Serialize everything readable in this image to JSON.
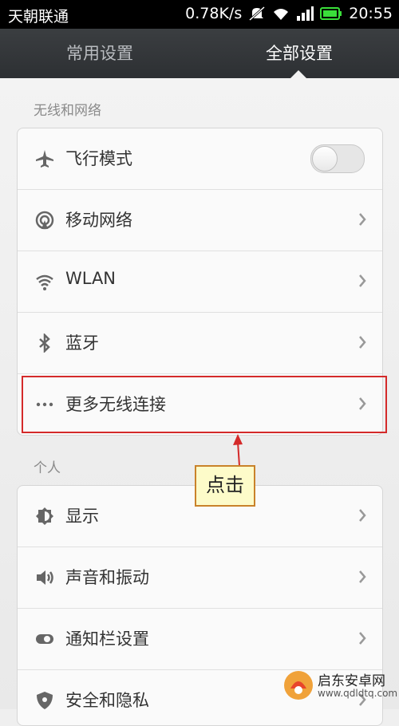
{
  "status_bar": {
    "carrier": "天朝联通",
    "speed": "0.78K/s",
    "time": "20:55"
  },
  "tabs": [
    {
      "label": "常用设置",
      "active": false
    },
    {
      "label": "全部设置",
      "active": true
    }
  ],
  "sections": {
    "wireless": {
      "title": "无线和网络",
      "items": [
        {
          "label": "飞行模式",
          "icon": "airplane-icon",
          "control": "toggle",
          "toggle_on": false
        },
        {
          "label": "移动网络",
          "icon": "mobile-network-icon",
          "control": "chevron"
        },
        {
          "label": "WLAN",
          "icon": "wifi-icon",
          "control": "chevron"
        },
        {
          "label": "蓝牙",
          "icon": "bluetooth-icon",
          "control": "chevron"
        },
        {
          "label": "更多无线连接",
          "icon": "more-icon",
          "control": "chevron"
        }
      ]
    },
    "personal": {
      "title": "个人",
      "items": [
        {
          "label": "显示",
          "icon": "brightness-icon",
          "control": "chevron"
        },
        {
          "label": "声音和振动",
          "icon": "sound-icon",
          "control": "chevron"
        },
        {
          "label": "通知栏设置",
          "icon": "notification-icon",
          "control": "chevron"
        },
        {
          "label": "安全和隐私",
          "icon": "shield-icon",
          "control": "chevron"
        }
      ]
    }
  },
  "annotation": {
    "callout_text": "点击",
    "highlight_color": "#d42a2a"
  },
  "watermark": {
    "line1": "启东安卓网",
    "line2": "www.qdldtq.com"
  },
  "colors": {
    "tab_bar": "#35383b",
    "status_green": "#3adf3a",
    "highlight": "#d42a2a"
  }
}
